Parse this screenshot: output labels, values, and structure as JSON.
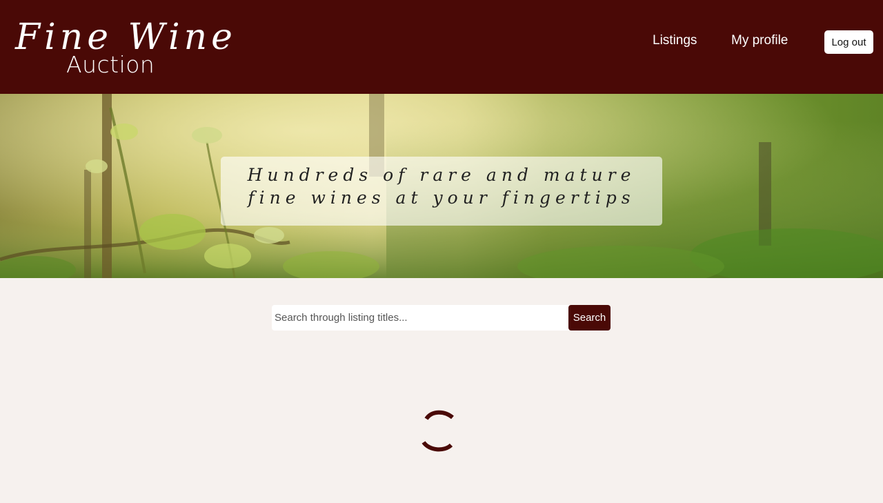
{
  "header": {
    "logo_script": "Fine Wine",
    "logo_sub": "Auction",
    "nav": {
      "listings": "Listings",
      "profile": "My profile"
    },
    "logout_label": "Log out"
  },
  "hero": {
    "caption": "Hundreds of rare and mature fine wines at your fingertips"
  },
  "search": {
    "placeholder": "Search through listing titles...",
    "value": "",
    "button_label": "Search"
  },
  "loading": {
    "state": "spinner"
  },
  "colors": {
    "brand": "#4a0906",
    "page_background": "#f6f1ee"
  }
}
